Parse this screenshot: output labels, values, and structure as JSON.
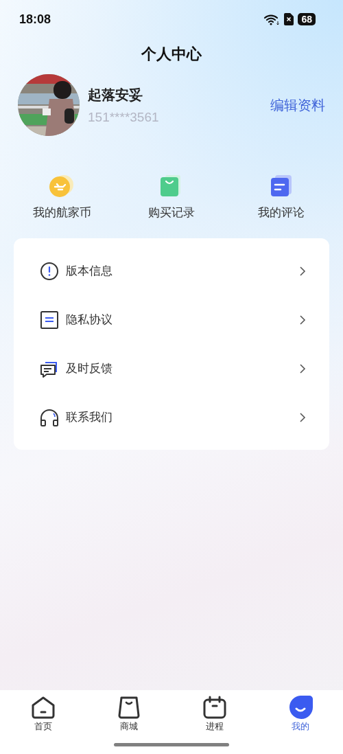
{
  "status_bar": {
    "time": "18:08",
    "battery": "68"
  },
  "title": "个人中心",
  "profile": {
    "name": "起落安妥",
    "phone": "151****3561",
    "edit_link": "编辑资料"
  },
  "shortcuts": [
    {
      "kind": "coin",
      "label": "我的航家币"
    },
    {
      "kind": "bag",
      "label": "购买记录"
    },
    {
      "kind": "doc",
      "label": "我的评论"
    }
  ],
  "menu": [
    {
      "kind": "info",
      "label": "版本信息"
    },
    {
      "kind": "privacy",
      "label": "隐私协议"
    },
    {
      "kind": "feedback",
      "label": "及时反馈"
    },
    {
      "kind": "contact",
      "label": "联系我们"
    }
  ],
  "tab_bar": [
    {
      "kind": "home",
      "label": "首页",
      "selected": false
    },
    {
      "kind": "shop",
      "label": "商城",
      "selected": false
    },
    {
      "kind": "progress",
      "label": "进程",
      "selected": false
    },
    {
      "kind": "me",
      "label": "我的",
      "selected": true
    }
  ]
}
